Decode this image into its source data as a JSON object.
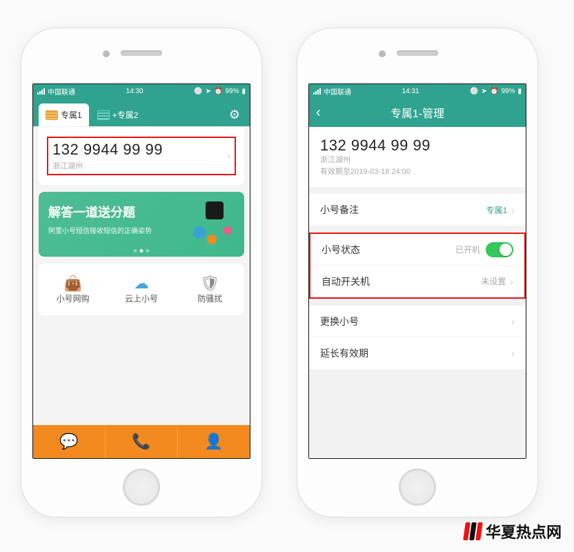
{
  "status": {
    "carrier": "中国联通",
    "time1": "14:30",
    "time2": "14:31",
    "battery": "99%"
  },
  "phone1": {
    "tabs": {
      "tab1": "专属1",
      "tab2": "+专属2"
    },
    "number": "132 9944 99 99",
    "location": "浙江湖州",
    "promo": {
      "title": "解答一道送分题",
      "subtitle": "阿里小号短信接收短信的正确姿势"
    },
    "features": {
      "f1": "小号网购",
      "f2": "云上小号",
      "f3": "防骚扰"
    }
  },
  "phone2": {
    "header": "专属1-管理",
    "number": "132 9944 99 99",
    "location": "浙江湖州",
    "expiry": "有效期至2019-03-18 24:00",
    "rows": {
      "remark_label": "小号备注",
      "remark_value": "专属1",
      "status_label": "小号状态",
      "status_value": "已开机",
      "auto_label": "自动开关机",
      "auto_value": "未设置",
      "change_label": "更换小号",
      "extend_label": "延长有效期"
    }
  },
  "watermark": "华夏热点网"
}
